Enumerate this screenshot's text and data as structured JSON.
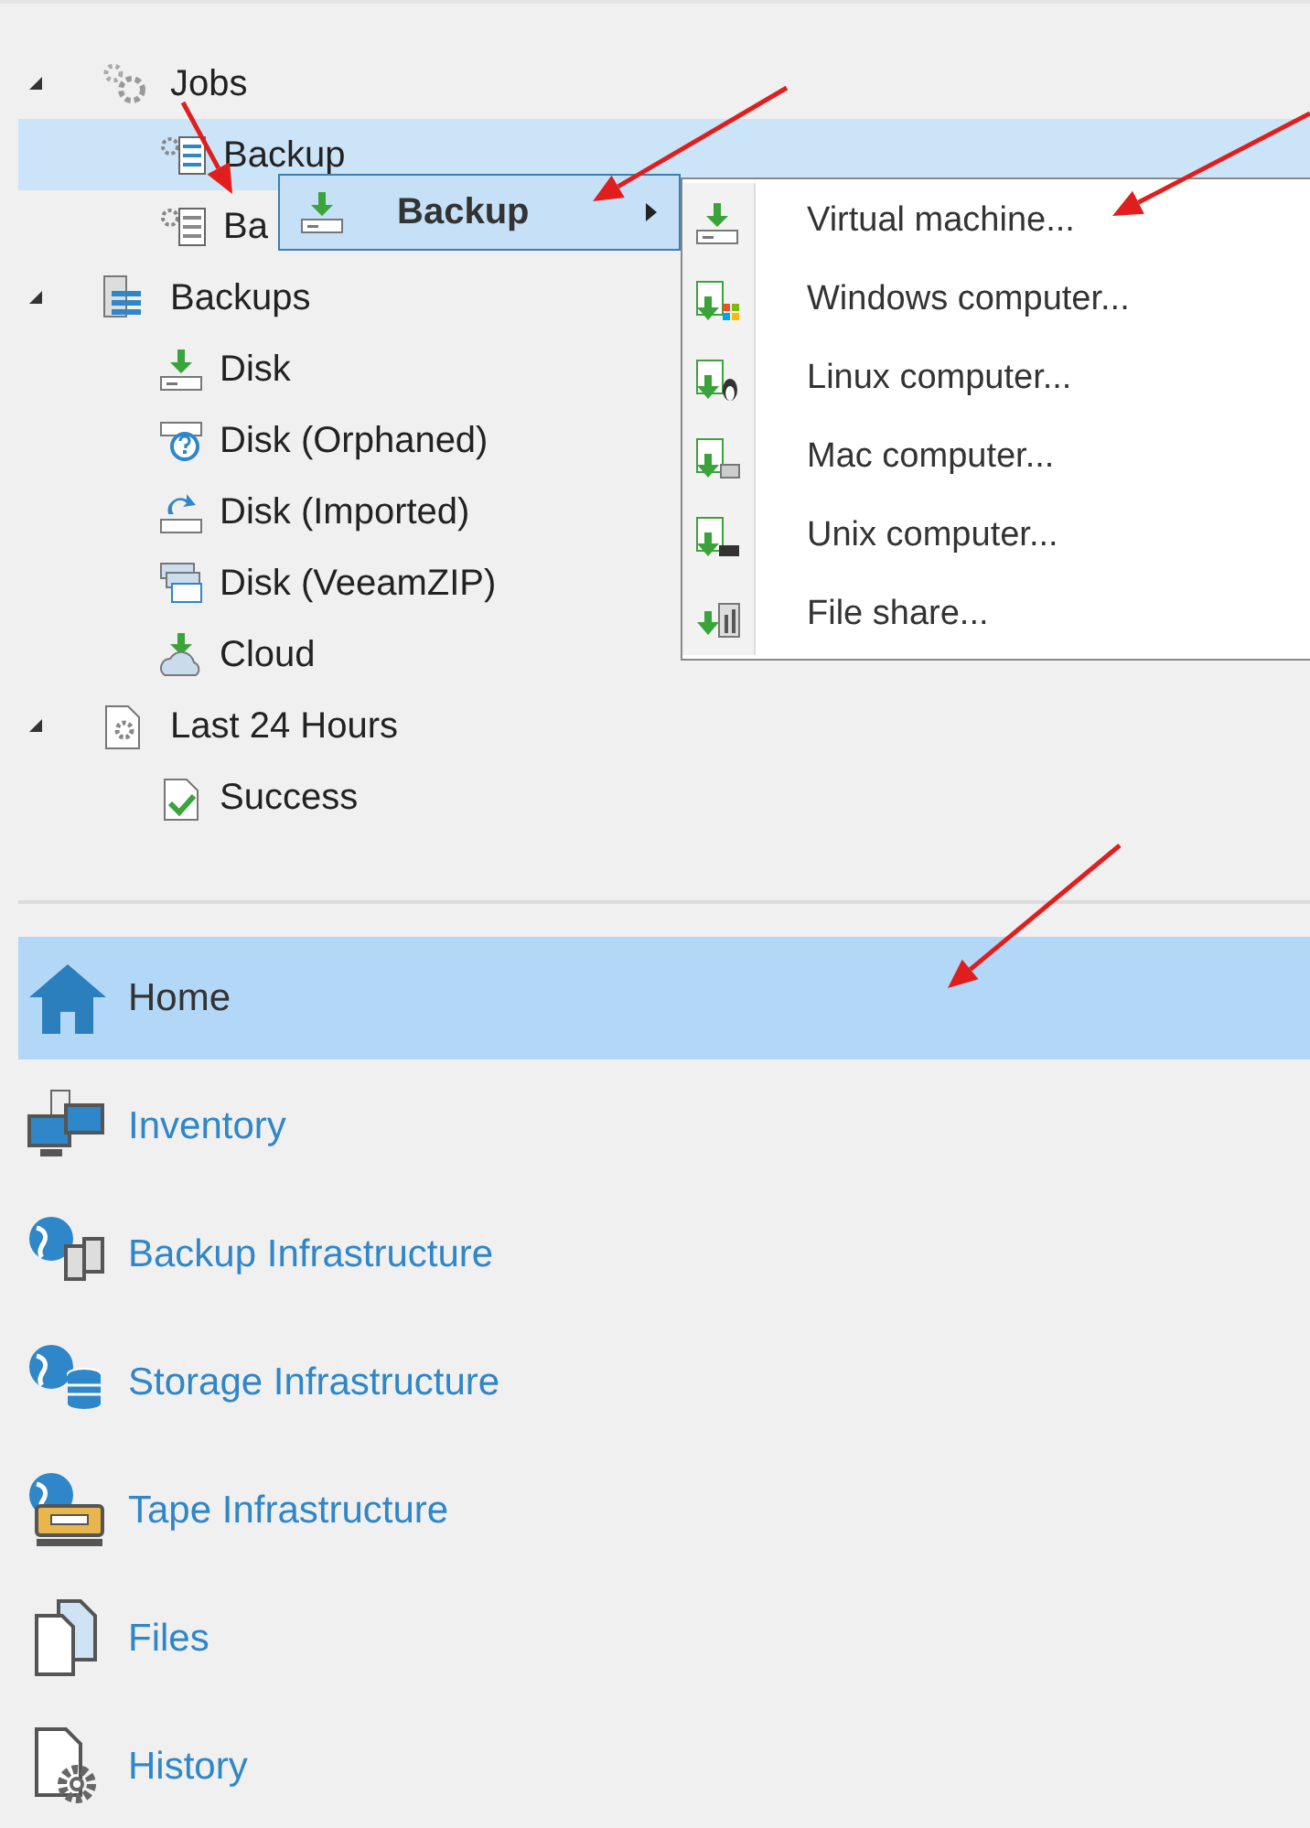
{
  "tree": [
    {
      "label": "Jobs",
      "expanded": true,
      "children": [
        {
          "label": "Backup",
          "selected": true
        },
        {
          "label": "Ba",
          "selected": false
        }
      ]
    },
    {
      "label": "Backups",
      "expanded": true,
      "children": [
        {
          "label": "Disk",
          "selected": false
        },
        {
          "label": "Disk (Orphaned)",
          "selected": false
        },
        {
          "label": "Disk (Imported)",
          "selected": false
        },
        {
          "label": "Disk (VeeamZIP)",
          "selected": false
        },
        {
          "label": "Cloud",
          "selected": false
        }
      ]
    },
    {
      "label": "Last 24 Hours",
      "expanded": true,
      "children": [
        {
          "label": "Success",
          "selected": false
        }
      ]
    }
  ],
  "context_menu": {
    "label": "Backup",
    "selected": true,
    "submenu": true
  },
  "submenu": [
    "Virtual machine...",
    "Windows computer...",
    "Linux computer...",
    "Mac computer...",
    "Unix computer...",
    "File share..."
  ],
  "nav": [
    {
      "label": "Home",
      "selected": true
    },
    {
      "label": "Inventory",
      "selected": false
    },
    {
      "label": "Backup Infrastructure",
      "selected": false
    },
    {
      "label": "Storage Infrastructure",
      "selected": false
    },
    {
      "label": "Tape Infrastructure",
      "selected": false
    },
    {
      "label": "Files",
      "selected": false
    },
    {
      "label": "History",
      "selected": false
    }
  ]
}
